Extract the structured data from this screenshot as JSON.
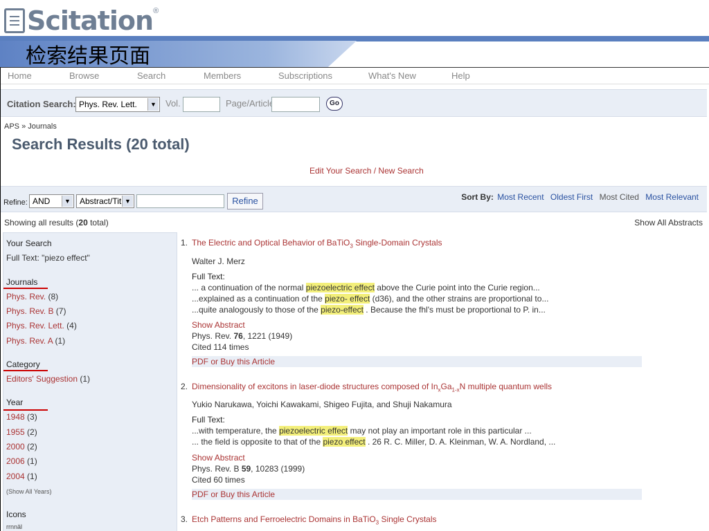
{
  "header": {
    "logo_text": "Scitation",
    "logo_reg": "®",
    "slide_title": "检索结果页面"
  },
  "nav": [
    "Home",
    "Browse",
    "Search",
    "Members",
    "Subscriptions",
    "What's New",
    "Help"
  ],
  "citation": {
    "label": "Citation Search:",
    "journal": "Phys. Rev. Lett.",
    "vol_label": "Vol.",
    "page_label": "Page/Article",
    "go": "Go"
  },
  "breadcrumb": "APS » Journals",
  "results_title": "Search Results (20 total)",
  "edit_link": "Edit Your Search / New Search",
  "refine": {
    "label": "Refine:",
    "op": "AND",
    "field": "Abstract/Title",
    "button": "Refine"
  },
  "sort": {
    "label": "Sort By:",
    "opts": [
      "Most Recent",
      "Oldest First",
      "Most Cited",
      "Most Relevant"
    ]
  },
  "showing": {
    "pre": "Showing all results (",
    "count": "20",
    "post": " total)"
  },
  "show_all_abstracts": "Show All Abstracts",
  "sidebar": {
    "your_search": "Your Search",
    "full_text": "Full Text: \"piezo effect\"",
    "journals_h": "Journals",
    "journals": [
      {
        "name": "Phys. Rev.",
        "count": " (8)"
      },
      {
        "name": "Phys. Rev. B",
        "count": " (7)"
      },
      {
        "name": "Phys. Rev. Lett.",
        "count": " (4)"
      },
      {
        "name": "Phys. Rev. A",
        "count": " (1)"
      }
    ],
    "category_h": "Category",
    "categories": [
      {
        "name": "Editors' Suggestion",
        "count": " (1)"
      }
    ],
    "year_h": "Year",
    "years": [
      {
        "name": "1948",
        "count": " (3)"
      },
      {
        "name": "1955",
        "count": " (2)"
      },
      {
        "name": "2000",
        "count": " (2)"
      },
      {
        "name": "2006",
        "count": " (1)"
      },
      {
        "name": "2004",
        "count": " (1)"
      }
    ],
    "show_all_years": "(Show All Years)",
    "icons_h": "Icons",
    "icons_frag": "rrnnäl"
  },
  "results": [
    {
      "num": "1.",
      "title_pre": "The Electric and Optical Behavior of BaTiO",
      "title_sub": "3",
      "title_post": " Single-Domain Crystals",
      "authors": "Walter J. Merz",
      "fulltext_label": "Full Text:",
      "snippets": [
        {
          "pre": "... a continuation of the normal ",
          "hl": "piezoelectric effect",
          "post": " above the Curie point into the Curie region..."
        },
        {
          "pre": "...explained as a continuation of the ",
          "hl": "piezo- effect",
          "post": " (d36), and the other strains are proportional to..."
        },
        {
          "pre": "...quite analogously to those of the ",
          "hl": "piezo-effect",
          "post": " . Because the fhl's must be proportional to P. in..."
        }
      ],
      "show_abstract": "Show Abstract",
      "cite_pre": "Phys. Rev. ",
      "cite_vol": "76",
      "cite_post": ", 1221 (1949)",
      "cited": "Cited 114 times",
      "pdf": "PDF or Buy this Article"
    },
    {
      "num": "2.",
      "title": "Dimensionality of excitons in laser-diode structures composed of In",
      "title_s1": "x",
      "title_m": "Ga",
      "title_s2": "1-x",
      "title_e": "N multiple quantum wells",
      "authors": "Yukio Narukawa, Yoichi Kawakami, Shigeo Fujita, and Shuji Nakamura",
      "fulltext_label": "Full Text:",
      "snippets": [
        {
          "pre": "...with temperature, the ",
          "hl": "piezoelectric effect",
          "post": " may not play an important role in this particular ..."
        },
        {
          "pre": "... the field is opposite to that of the ",
          "hl": "piezo effect",
          "post": " . 26 R. C. Miller, D. A. Kleinman, W. A. Nordland, ..."
        }
      ],
      "show_abstract": "Show Abstract",
      "cite_pre": "Phys. Rev. B ",
      "cite_vol": "59",
      "cite_post": ", 10283 (1999)",
      "cited": "Cited 60 times",
      "pdf": "PDF or Buy this Article"
    },
    {
      "num": "3.",
      "title_pre": "Etch Patterns and Ferroelectric Domains in BaTiO",
      "title_sub": "3",
      "title_post": " Single Crystals"
    }
  ]
}
